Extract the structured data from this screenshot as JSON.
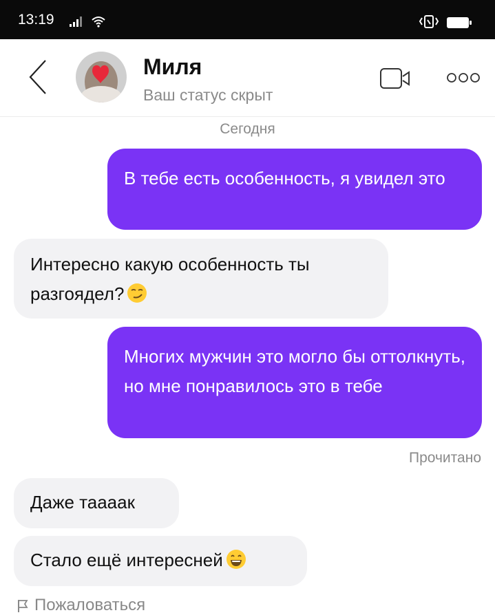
{
  "status_bar": {
    "time": "13:19"
  },
  "header": {
    "contact_name": "Миля",
    "contact_status": "Ваш статус скрыт"
  },
  "chat": {
    "date_separator": "Сегодня",
    "messages": [
      {
        "direction": "out",
        "text": "В тебе есть особенность, я увидел это"
      },
      {
        "direction": "in",
        "text": "Интересно какую особенность ты разгоядел?",
        "emoji": "smirking-face"
      },
      {
        "direction": "out",
        "text": "Многих мужчин это могло бы оттолкнуть, но мне понравилось это в тебе"
      },
      {
        "direction": "in",
        "text": "Даже таааак"
      },
      {
        "direction": "in",
        "text": "Стало ещё интересней",
        "emoji": "grinning-face"
      }
    ],
    "read_receipt": "Прочитано",
    "report_label": "Пожаловаться"
  },
  "colors": {
    "outgoing_bubble": "#7a33f5",
    "incoming_bubble": "#f2f2f4",
    "status_bar": "#0a0a0a"
  },
  "icons": [
    "signal-icon",
    "wifi-icon",
    "vibrate-icon",
    "battery-icon",
    "back-arrow-icon",
    "video-call-icon",
    "more-icon",
    "report-icon"
  ]
}
